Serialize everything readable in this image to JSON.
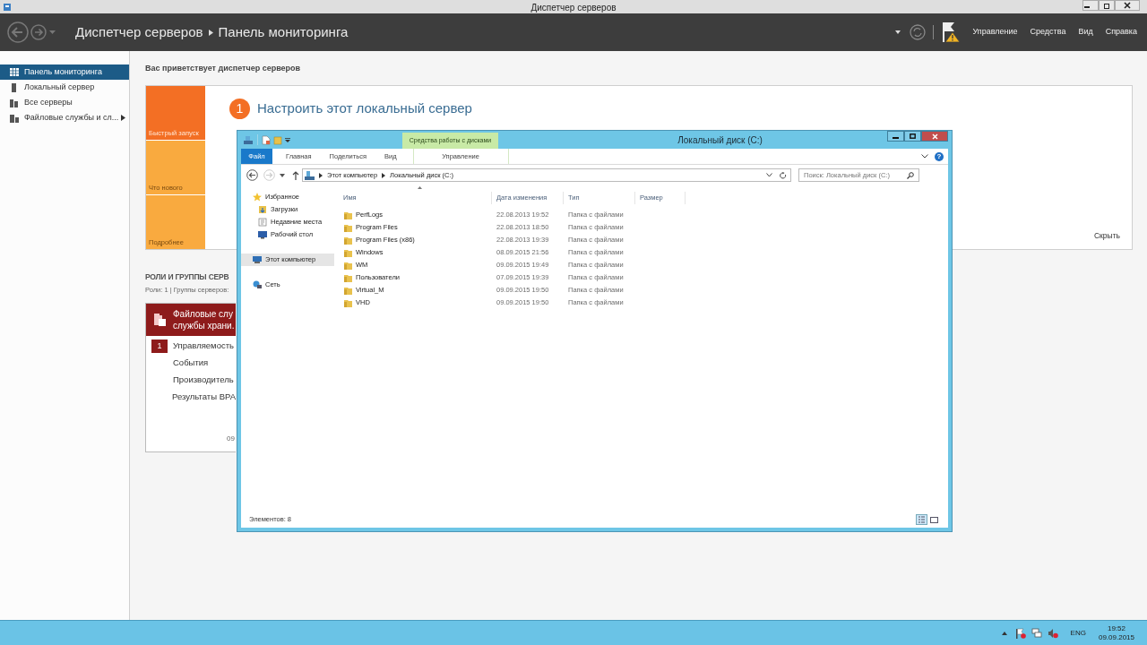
{
  "window": {
    "title": "Диспетчер серверов"
  },
  "header": {
    "breadcrumb": [
      "Диспетчер серверов",
      "Панель мониторинга"
    ],
    "menus": [
      "Управление",
      "Средства",
      "Вид",
      "Справка"
    ]
  },
  "sidebar": {
    "items": [
      {
        "label": "Панель мониторинга",
        "kind": "dashboard",
        "selected": true,
        "submenu": false
      },
      {
        "label": "Локальный сервер",
        "kind": "server",
        "selected": false,
        "submenu": false
      },
      {
        "label": "Все серверы",
        "kind": "servers",
        "selected": false,
        "submenu": false
      },
      {
        "label": "Файловые службы и сл...",
        "kind": "storage",
        "selected": false,
        "submenu": true
      }
    ]
  },
  "welcome": {
    "title": "Вас приветствует диспетчер серверов",
    "tiles": [
      {
        "label": "Быстрый запуск",
        "selected": true
      },
      {
        "label": "Что нового",
        "selected": false
      },
      {
        "label": "Подробнее",
        "selected": false
      }
    ],
    "step": {
      "number": "1",
      "text": "Настроить этот локальный сервер"
    },
    "hide": "Скрыть"
  },
  "roles": {
    "title": "РОЛИ И ГРУППЫ СЕРВ",
    "subtitle": "Роли: 1 | Группы серверов:",
    "card": {
      "title_lines": [
        "Файловые слу",
        "службы храни."
      ],
      "rows": [
        {
          "label": "Управляемость",
          "count": "1"
        },
        {
          "label": "События"
        },
        {
          "label": "Производитель"
        },
        {
          "label": "Результаты BPA"
        }
      ],
      "timestamp": "09"
    }
  },
  "explorer": {
    "title": "Локальный диск (C:)",
    "context_tab": "Средства работы с дисками",
    "ribbon_tabs": [
      {
        "label": "Файл",
        "kind": "file"
      },
      {
        "label": "Главная",
        "kind": "tab"
      },
      {
        "label": "Поделиться",
        "kind": "tab"
      },
      {
        "label": "Вид",
        "kind": "tab"
      },
      {
        "label": "Управление",
        "kind": "context"
      }
    ],
    "address": [
      "Этот компьютер",
      "Локальный диск (C:)"
    ],
    "search": {
      "placeholder": "Поиск: Локальный диск (C:)"
    },
    "help": "?",
    "nav": [
      {
        "label": "Избранное",
        "kind": "favorites",
        "selected": false,
        "children": [
          {
            "label": "Загрузки",
            "kind": "downloads",
            "selected": false
          },
          {
            "label": "Недавние места",
            "kind": "recent",
            "selected": false
          },
          {
            "label": "Рабочий стол",
            "kind": "desktop",
            "selected": false
          }
        ]
      },
      {
        "label": "Этот компьютер",
        "kind": "computer",
        "selected": true
      },
      {
        "label": "Сеть",
        "kind": "network",
        "selected": false
      }
    ],
    "columns": [
      "Имя",
      "Дата изменения",
      "Тип",
      "Размер"
    ],
    "rows": [
      {
        "name": "PerfLogs",
        "modified": "22.08.2013 19:52",
        "type": "Папка с файлами"
      },
      {
        "name": "Program Files",
        "modified": "22.08.2013 18:50",
        "type": "Папка с файлами"
      },
      {
        "name": "Program Files (x86)",
        "modified": "22.08.2013 19:39",
        "type": "Папка с файлами"
      },
      {
        "name": "Windows",
        "modified": "08.09.2015 21:56",
        "type": "Папка с файлами"
      },
      {
        "name": "WM",
        "modified": "09.09.2015 19:49",
        "type": "Папка с файлами"
      },
      {
        "name": "Пользователи",
        "modified": "07.09.2015 19:39",
        "type": "Папка с файлами"
      },
      {
        "name": "Virtual_M",
        "modified": "09.09.2015 19:50",
        "type": "Папка с файлами"
      },
      {
        "name": "VHD",
        "modified": "09.09.2015 19:50",
        "type": "Папка с файлами"
      }
    ],
    "status": "Элементов: 8",
    "views": [
      {
        "kind": "details",
        "selected": true
      },
      {
        "kind": "tiles",
        "selected": false
      }
    ]
  },
  "taskbar": {
    "language": "ENG",
    "time": "19:52",
    "date": "09.09.2015"
  }
}
